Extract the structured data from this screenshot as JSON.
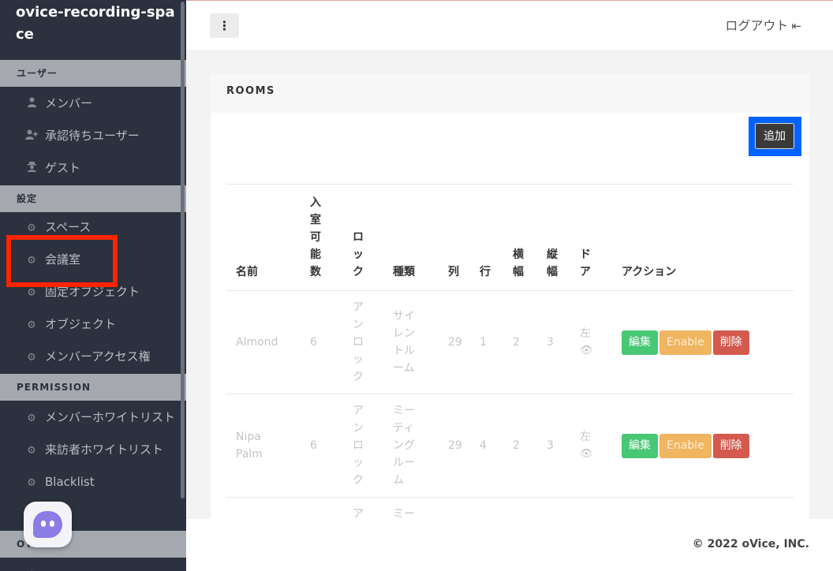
{
  "sidebar": {
    "brand": "ovice-recording-space",
    "sections": {
      "user": "ユーザー",
      "settings": "設定",
      "permission": "PERMISSION",
      "other": "OT"
    },
    "user_items": [
      {
        "label": "メンバー",
        "icon": "person-icon"
      },
      {
        "label": "承認待ちユーザー",
        "icon": "person-plus-icon"
      },
      {
        "label": "ゲスト",
        "icon": "guest-icon"
      }
    ],
    "settings_items": [
      {
        "label": "スペース",
        "icon": "gear-icon"
      },
      {
        "label": "会議室",
        "icon": "gear-icon"
      },
      {
        "label": "固定オブジェクト",
        "icon": "gear-icon"
      },
      {
        "label": "オブジェクト",
        "icon": "gear-icon"
      },
      {
        "label": "メンバーアクセス権",
        "icon": "gear-icon"
      }
    ],
    "permission_items": [
      {
        "label": "メンバーホワイトリスト",
        "icon": "gear-icon"
      },
      {
        "label": "来訪者ホワイトリスト",
        "icon": "gear-icon"
      },
      {
        "label": "Blacklist",
        "icon": "gear-icon"
      }
    ]
  },
  "topbar": {
    "menu_icon": "⋮",
    "logout_label": "ログアウト",
    "logout_icon": "⇤"
  },
  "card": {
    "title": "ROOMS",
    "add_label": "追加",
    "columns": [
      "名前",
      "入室可能数",
      "ロック",
      "種類",
      "列",
      "行",
      "横幅",
      "縦幅",
      "ドア",
      "アクション"
    ],
    "rows": [
      {
        "name": "Almond",
        "capacity": "6",
        "lock": "アンロック",
        "type": "サイレントルーム",
        "col": "29",
        "row": "1",
        "width": "2",
        "height": "3",
        "door": "左",
        "edit": "編集",
        "enable": "Enable",
        "delete": "削除"
      },
      {
        "name": "Nipa Palm",
        "capacity": "6",
        "lock": "アンロック",
        "type": "ミーティングルーム",
        "col": "29",
        "row": "4",
        "width": "2",
        "height": "3",
        "door": "左",
        "edit": "編集",
        "enable": "Enable",
        "delete": "削除"
      },
      {
        "name": "",
        "capacity": "",
        "lock": "ア",
        "type": "ミー",
        "col": "",
        "row": "",
        "width": "",
        "height": "",
        "door": ""
      }
    ]
  },
  "footer": {
    "copyright": "© 2022 oVice, INC."
  },
  "colors": {
    "sidebar_bg": "#2b313e",
    "highlight_red": "#ff2400",
    "highlight_blue": "#0062ff",
    "edit_green": "#48c774",
    "enable_orange": "#f0b560",
    "delete_red": "#d45a4f"
  }
}
